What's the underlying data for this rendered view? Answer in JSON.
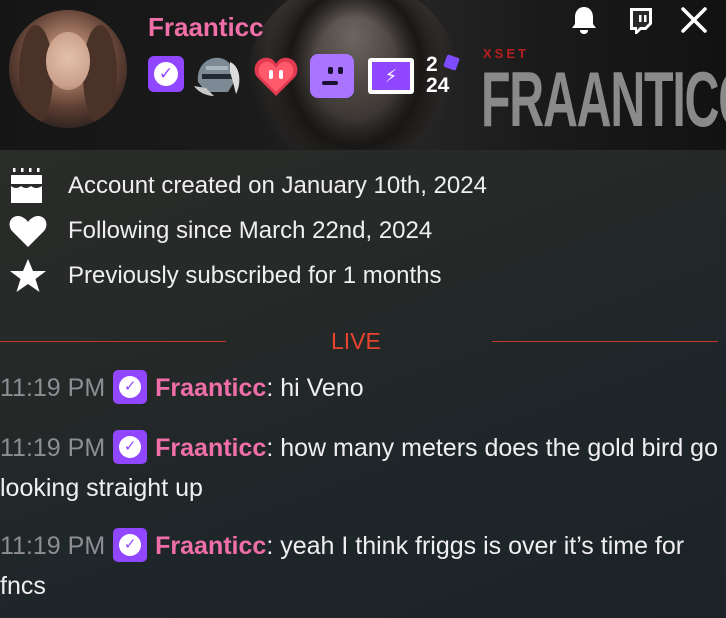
{
  "header": {
    "username": "Fraanticc",
    "banner_text": "FRAANTICC",
    "banner_small_text": "XSET",
    "badges": [
      {
        "icon": "verified-badge-icon"
      },
      {
        "icon": "knight-helmet-badge-icon"
      },
      {
        "icon": "heart-badge-icon"
      },
      {
        "icon": "ghost-badge-icon"
      },
      {
        "icon": "battery-bolt-badge-icon"
      },
      {
        "icon": "year-2024-badge-icon",
        "text": "2024"
      }
    ],
    "icons": [
      "bell-icon",
      "twitch-icon",
      "close-icon"
    ],
    "colors": {
      "username": "#f16fa9",
      "badge": "#9146ff"
    }
  },
  "info": {
    "account_created": "Account created on January 10th, 2024",
    "following_since": "Following since March 22nd, 2024",
    "subscribed": "Previously subscribed for 1 months"
  },
  "divider": {
    "label": "LIVE",
    "color": "#e8432e"
  },
  "messages": [
    {
      "time": "11:19 PM",
      "user": "Fraanticc",
      "sep": ": ",
      "text": "hi Veno"
    },
    {
      "time": "11:19 PM",
      "user": "Fraanticc",
      "sep": ": ",
      "text": "how many meters does the gold bird go looking straight up"
    },
    {
      "time": "11:19 PM",
      "user": "Fraanticc",
      "sep": ": ",
      "text": "yeah I think friggs is over it’s time for fncs"
    }
  ]
}
